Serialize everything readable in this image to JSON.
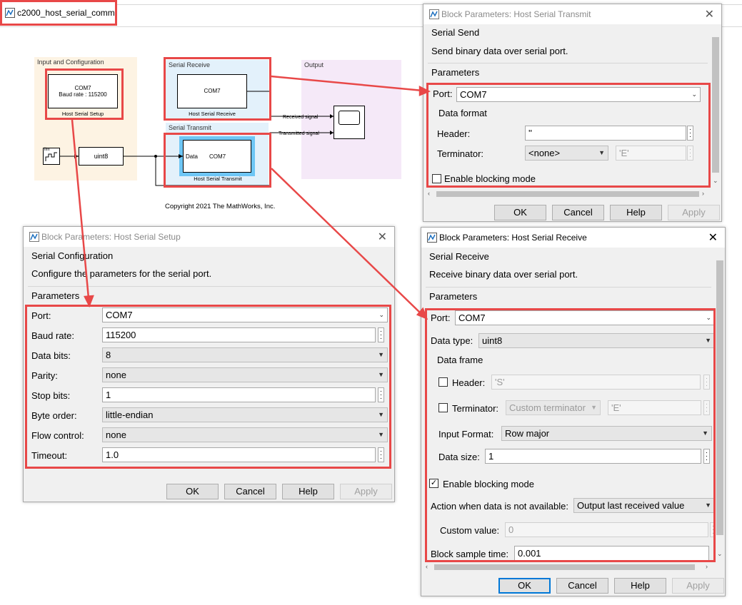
{
  "model": {
    "title": "c2000_host_serial_comm",
    "copyright": "Copyright 2021 The MathWorks, Inc.",
    "areas": {
      "input": "Input and Configuration",
      "receive": "Serial Receive",
      "transmit": "Serial Transmit",
      "output": "Output"
    },
    "blocks": {
      "setup_port": "COM7",
      "setup_baud": "Baud rate : 115200",
      "setup_name": "Host Serial Setup",
      "receive_port": "COM7",
      "receive_name": "Host Serial Receive",
      "transmit_data": "Data",
      "transmit_port": "COM7",
      "transmit_name": "Host Serial Transmit",
      "uint8": "uint8",
      "signal_icon": "lim"
    },
    "signals": {
      "received": "Received signal",
      "transmitted": "Transmitted signal"
    }
  },
  "transmit_dialog": {
    "title": "Block Parameters: Host Serial Transmit",
    "group": "Serial Send",
    "description": "Send binary data over serial port.",
    "parameters": "Parameters",
    "port_label": "Port:",
    "port_value": "COM7",
    "data_format": "Data format",
    "header_label": "Header:",
    "header_value": "''",
    "terminator_label": "Terminator:",
    "terminator_value": "<none>",
    "terminator_custom": "'E'",
    "blocking_label": "Enable blocking mode",
    "buttons": {
      "ok": "OK",
      "cancel": "Cancel",
      "help": "Help",
      "apply": "Apply"
    }
  },
  "setup_dialog": {
    "title": "Block Parameters: Host Serial Setup",
    "group": "Serial Configuration",
    "description": "Configure the parameters for the serial port.",
    "parameters": "Parameters",
    "rows": [
      {
        "label": "Port:",
        "value": "COM7"
      },
      {
        "label": "Baud rate:",
        "value": "115200"
      },
      {
        "label": "Data bits:",
        "value": "8"
      },
      {
        "label": "Parity:",
        "value": "none"
      },
      {
        "label": "Stop bits:",
        "value": "1"
      },
      {
        "label": "Byte order:",
        "value": "little-endian"
      },
      {
        "label": "Flow control:",
        "value": "none"
      },
      {
        "label": "Timeout:",
        "value": "1.0"
      }
    ],
    "buttons": {
      "ok": "OK",
      "cancel": "Cancel",
      "help": "Help",
      "apply": "Apply"
    }
  },
  "receive_dialog": {
    "title": "Block Parameters: Host Serial Receive",
    "group": "Serial Receive",
    "description": "Receive binary data over serial port.",
    "parameters": "Parameters",
    "port_label": "Port:",
    "port_value": "COM7",
    "datatype_label": "Data type:",
    "datatype_value": "uint8",
    "data_frame": "Data frame",
    "header_label": "Header:",
    "header_value": "'S'",
    "terminator_label": "Terminator:",
    "terminator_value": "Custom terminator",
    "terminator_custom": "'E'",
    "input_format_label": "Input Format:",
    "input_format_value": "Row major",
    "data_size_label": "Data size:",
    "data_size_value": "1",
    "blocking_label": "Enable blocking mode",
    "action_label": "Action when data is not available:",
    "action_value": "Output last received value",
    "custom_label": "Custom value:",
    "custom_value": "0",
    "sample_label": "Block sample time:",
    "sample_value": "0.001",
    "buttons": {
      "ok": "OK",
      "cancel": "Cancel",
      "help": "Help",
      "apply": "Apply"
    }
  },
  "colors": {
    "highlight": "#e84848",
    "default_button": "#0078d7"
  }
}
